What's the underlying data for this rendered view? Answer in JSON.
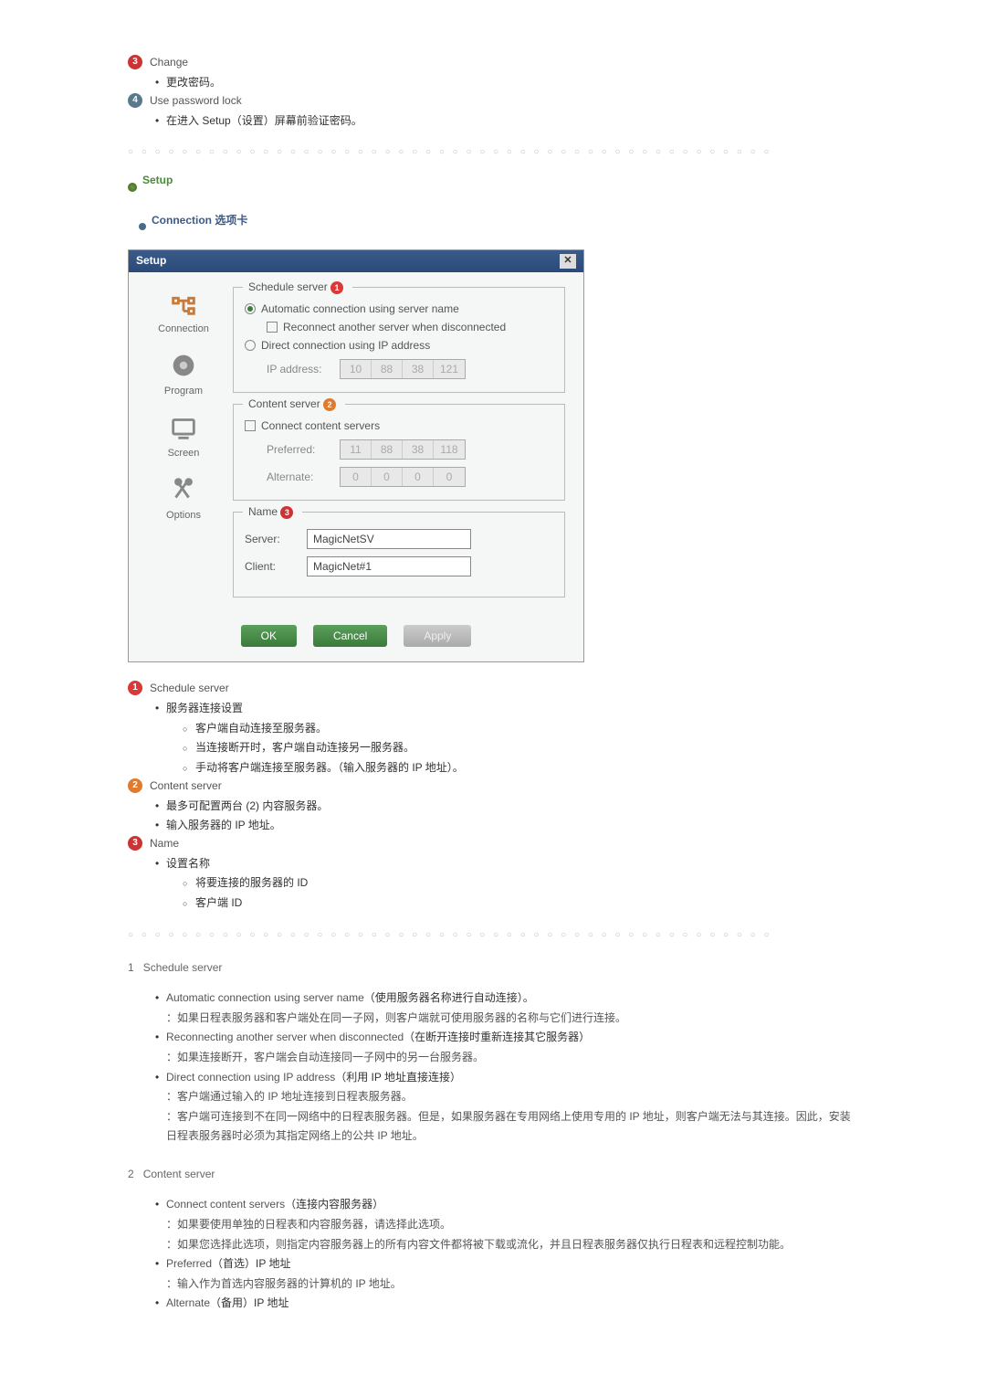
{
  "top": {
    "change_label": "Change",
    "change_desc": "更改密码。",
    "lock_label": "Use password lock",
    "lock_desc": "在进入 Setup（设置）屏幕前验证密码。"
  },
  "setup": {
    "heading": "Setup",
    "connection_tab": "Connection 选项卡"
  },
  "dialog": {
    "title": "Setup",
    "tabs": {
      "connection": "Connection",
      "program": "Program",
      "screen": "Screen",
      "options": "Options"
    },
    "fs1": {
      "legend": "Schedule server",
      "auto": "Automatic connection using server name",
      "reconnect": "Reconnect another server when disconnected",
      "direct": "Direct connection using IP address",
      "ip_label": "IP address:",
      "ip": [
        "10",
        "88",
        "38",
        "121"
      ]
    },
    "fs2": {
      "legend": "Content server",
      "connect": "Connect content servers",
      "preferred_label": "Preferred:",
      "preferred_ip": [
        "11",
        "88",
        "38",
        "118"
      ],
      "alternate_label": "Alternate:",
      "alternate_ip": [
        "0",
        "0",
        "0",
        "0"
      ]
    },
    "fs3": {
      "legend": "Name",
      "server_label": "Server:",
      "server_val": "MagicNetSV",
      "client_label": "Client:",
      "client_val": "MagicNet#1"
    },
    "buttons": {
      "ok": "OK",
      "cancel": "Cancel",
      "apply": "Apply"
    }
  },
  "notes": {
    "schedule": {
      "title": "Schedule server",
      "b1": "服务器连接设置",
      "s1": "客户端自动连接至服务器。",
      "s2": "当连接断开时，客户端自动连接另一服务器。",
      "s3": "手动将客户端连接至服务器。（输入服务器的 IP 地址）。"
    },
    "content": {
      "title": "Content server",
      "b1": "最多可配置两台 (2) 内容服务器。",
      "b2": "输入服务器的 IP 地址。"
    },
    "name": {
      "title": "Name",
      "b1": "设置名称",
      "s1": "将要连接的服务器的 ID",
      "s2": "客户端 ID"
    }
  },
  "lower": {
    "sec1": {
      "num": "1",
      "title": "Schedule server",
      "i1a": "Automatic connection using server name",
      "i1b": "（使用服务器名称进行自动连接）。",
      "i1c": "：如果日程表服务器和客户端处在同一子网，则客户端就可使用服务器的名称与它们进行连接。",
      "i2a": "Reconnecting another server when disconnected",
      "i2b": "（在断开连接时重新连接其它服务器）",
      "i2c": "：如果连接断开，客户端会自动连接同一子网中的另一台服务器。",
      "i3a": "Direct connection using IP address",
      "i3b": "（利用 IP 地址直接连接）",
      "i3c": "：客户端通过输入的 IP 地址连接到日程表服务器。",
      "i3d": "：客户端可连接到不在同一网络中的日程表服务器。但是，如果服务器在专用网络上使用专用的 IP 地址，则客户端无法与其连接。因此，安装日程表服务器时必须为其指定网络上的公共 IP 地址。"
    },
    "sec2": {
      "num": "2",
      "title": "Content server",
      "i1a": "Connect content servers",
      "i1b": "（连接内容服务器）",
      "i1c": "：如果要使用单独的日程表和内容服务器，请选择此选项。",
      "i1d": "：如果您选择此选项，则指定内容服务器上的所有内容文件都将被下载或流化，并且日程表服务器仅执行日程表和远程控制功能。",
      "i2a": "Preferred",
      "i2b": "（首选）IP 地址",
      "i2c": "：输入作为首选内容服务器的计算机的 IP 地址。",
      "i3a": "Alternate",
      "i3b": "（备用）IP 地址"
    }
  }
}
